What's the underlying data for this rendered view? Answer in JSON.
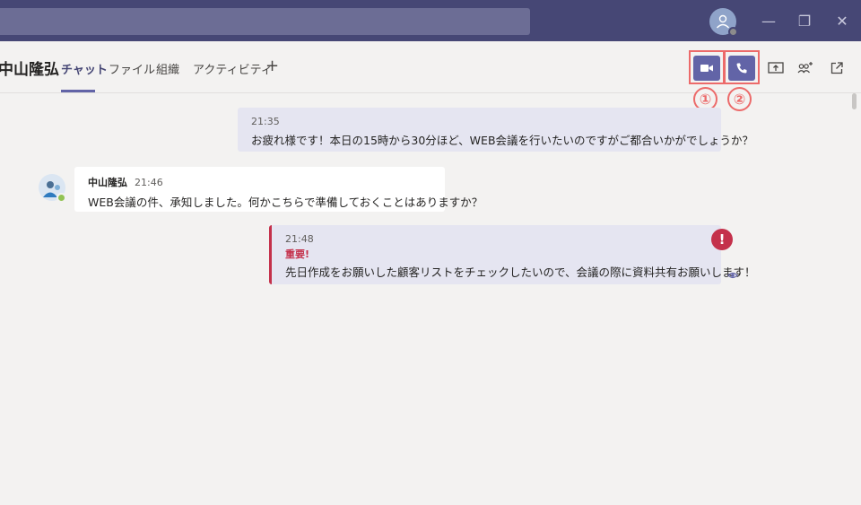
{
  "window": {
    "search_placeholder": "",
    "min_icon": "—",
    "max_icon": "❐",
    "close_icon": "✕"
  },
  "header": {
    "chat_title": "中山隆弘",
    "tabs": [
      {
        "label": "チャット",
        "active": true
      },
      {
        "label": "ファイル"
      },
      {
        "label": "組織"
      },
      {
        "label": "アクティビティ"
      }
    ],
    "add_tab_icon": "+",
    "markers": [
      "①",
      "②"
    ],
    "colors": {
      "accent": "#6264a7",
      "highlight": "#ec6a6a"
    }
  },
  "messages": [
    {
      "id": "msg1",
      "from_me": true,
      "time": "21:35",
      "text": "お疲れ様です！本日の15時から30分ほど、WEB会議を行いたいのですがご都合いかがでしょうか？"
    },
    {
      "id": "msg2",
      "from_me": false,
      "sender": "中山隆弘",
      "time": "21:46",
      "text": "WEB会議の件、承知しました。何かこちらで準備しておくことはありますか？"
    },
    {
      "id": "msg3",
      "from_me": true,
      "time": "21:48",
      "important_label": "重要!",
      "important_icon": "!",
      "text": "先日作成をお願いした顧客リストをチェックしたいので、会議の際に資料共有お願いします！"
    }
  ]
}
